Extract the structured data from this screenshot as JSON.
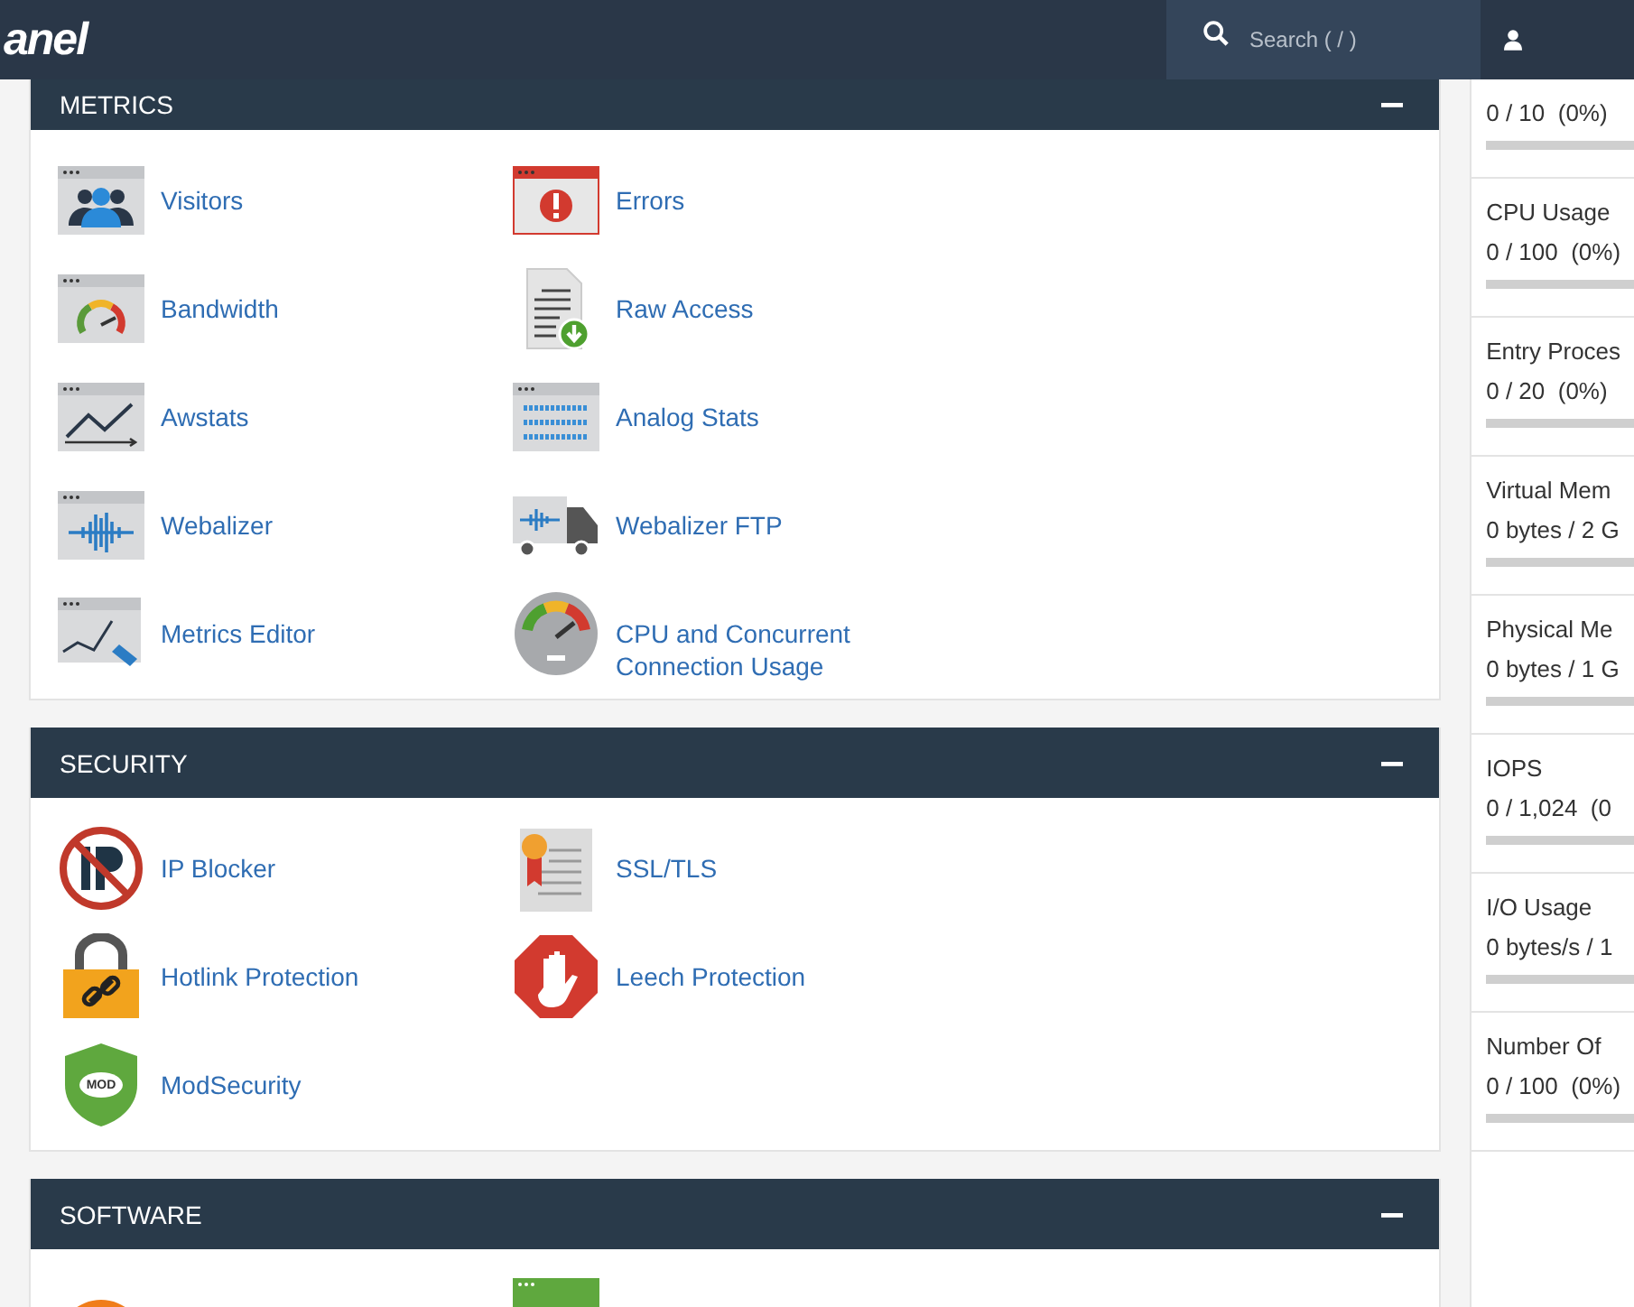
{
  "topbar": {
    "logo": "anel",
    "search": {
      "placeholder": "Search ( / )"
    }
  },
  "sections": [
    {
      "title": "METRICS",
      "expanded": true,
      "items": [
        {
          "label": "Visitors"
        },
        {
          "label": "Errors"
        },
        {
          "label": "Bandwidth"
        },
        {
          "label": "Raw Access"
        },
        {
          "label": "Awstats"
        },
        {
          "label": "Analog Stats"
        },
        {
          "label": "Webalizer"
        },
        {
          "label": "Webalizer FTP"
        },
        {
          "label": "Metrics Editor"
        },
        {
          "label": "CPU and Concurrent Connection Usage"
        }
      ]
    },
    {
      "title": "SECURITY",
      "expanded": true,
      "items": [
        {
          "label": "IP Blocker"
        },
        {
          "label": "SSL/TLS"
        },
        {
          "label": "Hotlink Protection"
        },
        {
          "label": "Leech Protection"
        },
        {
          "label": "ModSecurity",
          "icon_text": "MOD"
        }
      ]
    },
    {
      "title": "SOFTWARE",
      "expanded": true
    }
  ],
  "sidebar": {
    "stats": [
      {
        "value": "0 / 10  (0%)"
      },
      {
        "label": "CPU Usage",
        "value": "0 / 100  (0%)"
      },
      {
        "label": "Entry Proces",
        "value": "0 / 20  (0%)"
      },
      {
        "label": "Virtual Mem",
        "value": "0 bytes / 2 G"
      },
      {
        "label": "Physical Me",
        "value": "0 bytes / 1 G"
      },
      {
        "label": "IOPS",
        "value": "0 / 1,024  (0"
      },
      {
        "label": "I/O Usage",
        "value": "0 bytes/s / 1"
      },
      {
        "label": "Number Of",
        "value": "0 / 100  (0%)"
      }
    ]
  }
}
